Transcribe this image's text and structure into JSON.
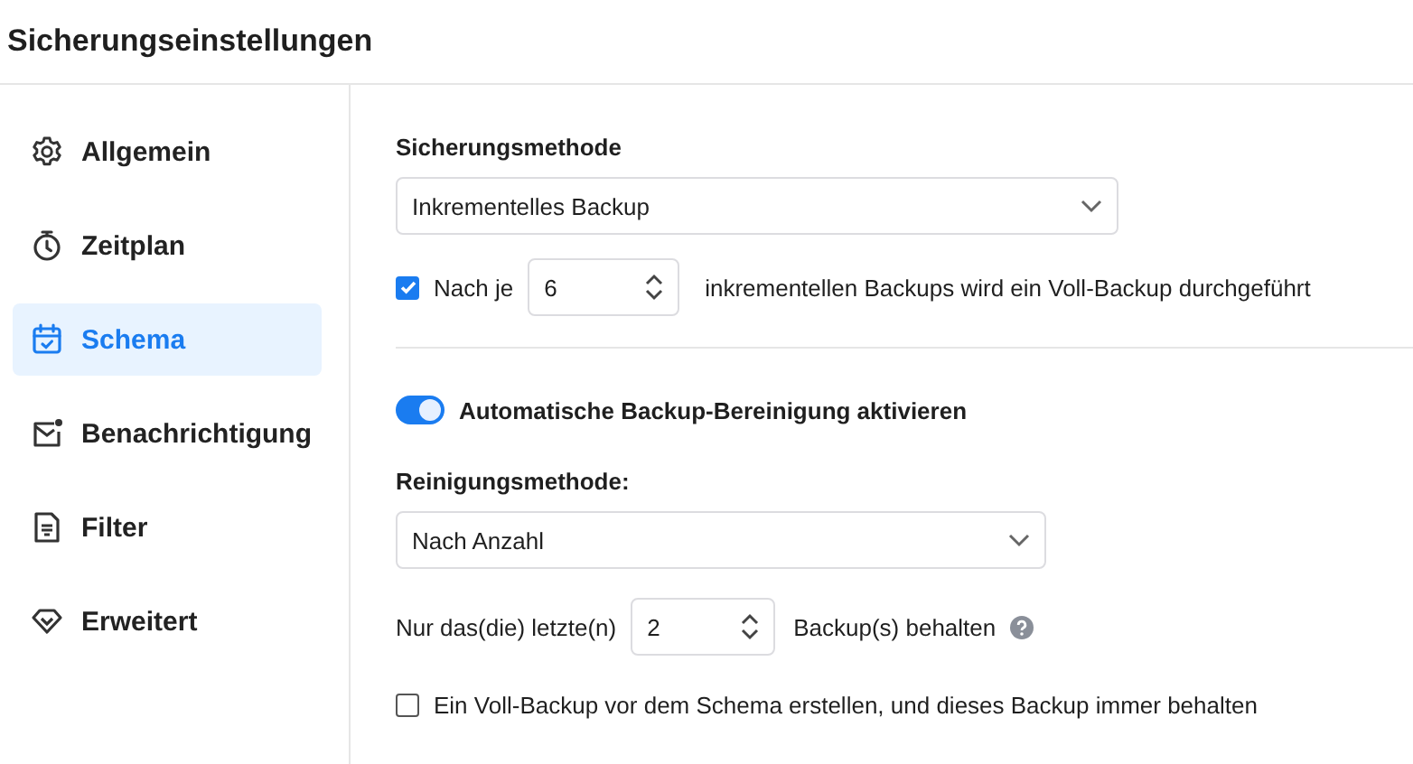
{
  "window": {
    "title": "Sicherungseinstellungen"
  },
  "sidebar": {
    "items": [
      {
        "label": "Allgemein",
        "kind": "gear",
        "selected": false
      },
      {
        "label": "Zeitplan",
        "kind": "stopwatch",
        "selected": false
      },
      {
        "label": "Schema",
        "kind": "calendar",
        "selected": true
      },
      {
        "label": "Benachrichtigung",
        "kind": "mail",
        "selected": false
      },
      {
        "label": "Filter",
        "kind": "document",
        "selected": false
      },
      {
        "label": "Erweitert",
        "kind": "diamond",
        "selected": false
      }
    ]
  },
  "backup_method": {
    "label": "Sicherungsmethode",
    "value": "Inkrementelles Backup"
  },
  "full_backup_interval": {
    "checked": true,
    "prefix": "Nach je",
    "value": "6",
    "suffix": "inkrementellen Backups wird ein Voll-Backup durchgeführt"
  },
  "auto_cleanup": {
    "on": true,
    "label": "Automatische Backup-Bereinigung aktivieren"
  },
  "cleanup_method": {
    "label": "Reinigungsmethode:",
    "value": "Nach Anzahl"
  },
  "keep_count": {
    "prefix": "Nur das(die) letzte(n)",
    "value": "2",
    "suffix": "Backup(s) behalten"
  },
  "initial_full_backup": {
    "checked": false,
    "label": "Ein Voll-Backup vor dem Schema erstellen, und dieses Backup immer behalten"
  }
}
